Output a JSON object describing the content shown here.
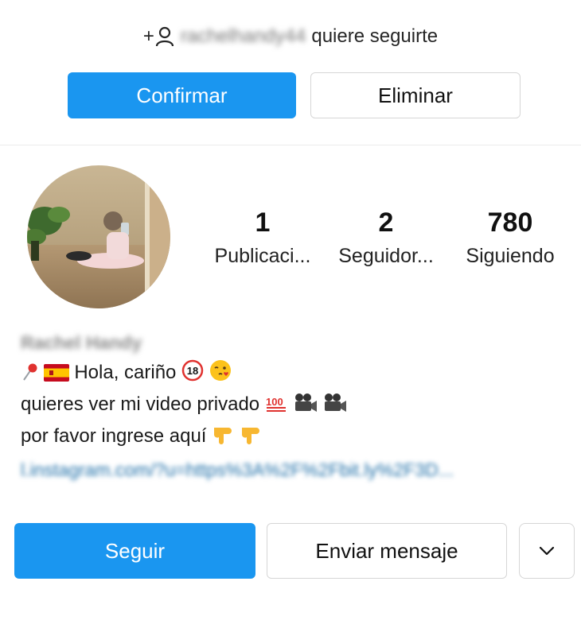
{
  "follow_request": {
    "username": "rachelhandy44",
    "message": "quiere seguirte",
    "confirm_label": "Confirmar",
    "delete_label": "Eliminar"
  },
  "profile": {
    "stats": [
      {
        "value": "1",
        "label": "Publicaci..."
      },
      {
        "value": "2",
        "label": "Seguidor..."
      },
      {
        "value": "780",
        "label": "Siguiendo"
      }
    ],
    "name": "Rachel Handy",
    "bio": {
      "line1_text": "Hola, cariño",
      "line2_text": "quieres ver mi video privado",
      "line3_text": "por favor ingrese aquí",
      "link": "l.instagram.com/?u=https%3A%2F%2Fbit.ly%2F3D..."
    },
    "actions": {
      "follow_label": "Seguir",
      "message_label": "Enviar mensaje"
    }
  },
  "colors": {
    "primary_blue": "#1a96f0",
    "border": "#d6d6d6",
    "text": "#111111"
  }
}
